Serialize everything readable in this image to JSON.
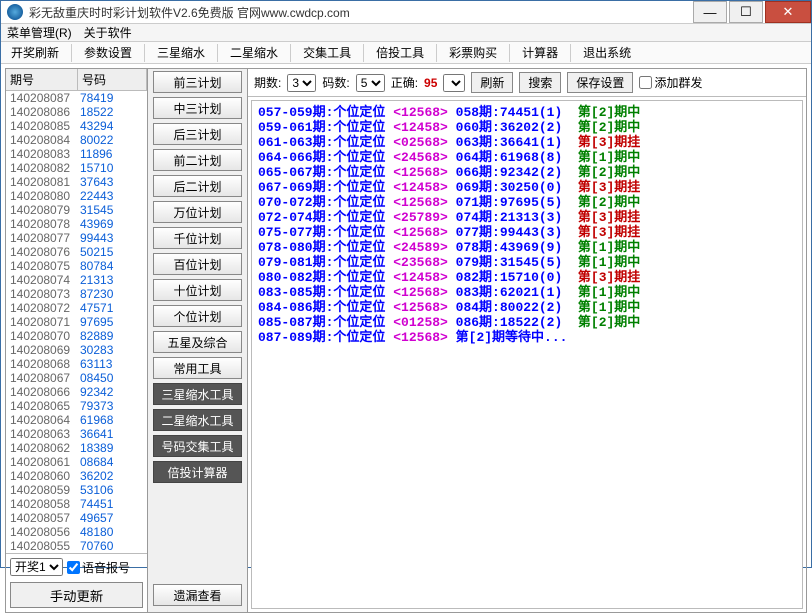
{
  "title": "彩无敌重庆时时彩计划软件V2.6免费版    官网www.cwdcp.com",
  "menu": {
    "m1": "菜单管理(R)",
    "m2": "关于软件"
  },
  "toolbar": [
    "开奖刷新",
    "参数设置",
    "三星缩水",
    "二星缩水",
    "交集工具",
    "倍投工具",
    "彩票购买",
    "计算器",
    "退出系统"
  ],
  "list": {
    "h1": "期号",
    "h2": "号码",
    "rows": [
      [
        "140208087",
        "78419"
      ],
      [
        "140208086",
        "18522"
      ],
      [
        "140208085",
        "43294"
      ],
      [
        "140208084",
        "80022"
      ],
      [
        "140208083",
        "11896"
      ],
      [
        "140208082",
        "15710"
      ],
      [
        "140208081",
        "37643"
      ],
      [
        "140208080",
        "22443"
      ],
      [
        "140208079",
        "31545"
      ],
      [
        "140208078",
        "43969"
      ],
      [
        "140208077",
        "99443"
      ],
      [
        "140208076",
        "50215"
      ],
      [
        "140208075",
        "80784"
      ],
      [
        "140208074",
        "21313"
      ],
      [
        "140208073",
        "87230"
      ],
      [
        "140208072",
        "47571"
      ],
      [
        "140208071",
        "97695"
      ],
      [
        "140208070",
        "82889"
      ],
      [
        "140208069",
        "30283"
      ],
      [
        "140208068",
        "63113"
      ],
      [
        "140208067",
        "08450"
      ],
      [
        "140208066",
        "92342"
      ],
      [
        "140208065",
        "79373"
      ],
      [
        "140208064",
        "61968"
      ],
      [
        "140208063",
        "36641"
      ],
      [
        "140208062",
        "18389"
      ],
      [
        "140208061",
        "08684"
      ],
      [
        "140208060",
        "36202"
      ],
      [
        "140208059",
        "53106"
      ],
      [
        "140208058",
        "74451"
      ],
      [
        "140208057",
        "49657"
      ],
      [
        "140208056",
        "48180"
      ],
      [
        "140208055",
        "70760"
      ]
    ]
  },
  "leftbottom": {
    "sel": "开奖1",
    "chk": "语音报号",
    "btn": "手动更新"
  },
  "mid": {
    "light": [
      "前三计划",
      "中三计划",
      "后三计划",
      "前二计划",
      "后二计划",
      "万位计划",
      "千位计划",
      "百位计划",
      "十位计划",
      "个位计划",
      "五星及综合",
      "常用工具"
    ],
    "dark": [
      "三星缩水工具",
      "二星缩水工具",
      "号码交集工具",
      "倍投计算器"
    ],
    "last": "遗漏查看"
  },
  "filter": {
    "l1": "期数:",
    "v1": "3",
    "l2": "码数:",
    "v2": "5",
    "l3": "正确:",
    "v3": "95",
    "b1": "刷新",
    "b2": "搜索",
    "b3": "保存设置",
    "chk": "添加群发"
  },
  "results": [
    {
      "p": "057-059期:个位定位",
      "c": "<12568>",
      "r": "058期:74451(1)",
      "t": "第[2]期中",
      "k": 1
    },
    {
      "p": "059-061期:个位定位",
      "c": "<12458>",
      "r": "060期:36202(2)",
      "t": "第[2]期中",
      "k": 1
    },
    {
      "p": "061-063期:个位定位",
      "c": "<02568>",
      "r": "063期:36641(1)",
      "t": "第[3]期挂",
      "k": 2
    },
    {
      "p": "064-066期:个位定位",
      "c": "<24568>",
      "r": "064期:61968(8)",
      "t": "第[1]期中",
      "k": 1
    },
    {
      "p": "065-067期:个位定位",
      "c": "<12568>",
      "r": "066期:92342(2)",
      "t": "第[2]期中",
      "k": 1
    },
    {
      "p": "067-069期:个位定位",
      "c": "<12458>",
      "r": "069期:30250(0)",
      "t": "第[3]期挂",
      "k": 2
    },
    {
      "p": "070-072期:个位定位",
      "c": "<12568>",
      "r": "071期:97695(5)",
      "t": "第[2]期中",
      "k": 1
    },
    {
      "p": "072-074期:个位定位",
      "c": "<25789>",
      "r": "074期:21313(3)",
      "t": "第[3]期挂",
      "k": 2
    },
    {
      "p": "075-077期:个位定位",
      "c": "<12568>",
      "r": "077期:99443(3)",
      "t": "第[3]期挂",
      "k": 2
    },
    {
      "p": "078-080期:个位定位",
      "c": "<24589>",
      "r": "078期:43969(9)",
      "t": "第[1]期中",
      "k": 1
    },
    {
      "p": "079-081期:个位定位",
      "c": "<23568>",
      "r": "079期:31545(5)",
      "t": "第[1]期中",
      "k": 1
    },
    {
      "p": "080-082期:个位定位",
      "c": "<12458>",
      "r": "082期:15710(0)",
      "t": "第[3]期挂",
      "k": 2
    },
    {
      "p": "083-085期:个位定位",
      "c": "<12568>",
      "r": "083期:62021(1)",
      "t": "第[1]期中",
      "k": 1
    },
    {
      "p": "084-086期:个位定位",
      "c": "<12568>",
      "r": "084期:80022(2)",
      "t": "第[1]期中",
      "k": 1
    },
    {
      "p": "085-087期:个位定位",
      "c": "<01258>",
      "r": "086期:18522(2)",
      "t": "第[2]期中",
      "k": 1
    },
    {
      "p": "087-089期:个位定位",
      "c": "<12568>",
      "r": "第[2]期等待中...",
      "t": "",
      "k": 3
    }
  ]
}
